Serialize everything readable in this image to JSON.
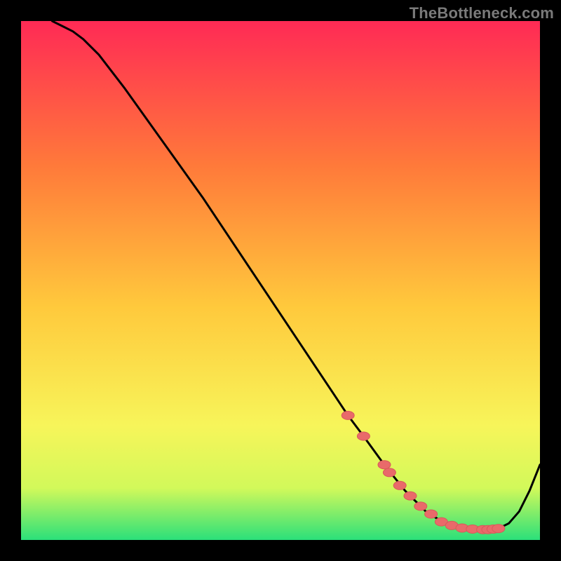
{
  "watermark": "TheBottleneck.com",
  "colors": {
    "gradient_top": "#ff2a55",
    "gradient_mid_upper": "#ff7a3a",
    "gradient_mid": "#ffc93c",
    "gradient_mid_lower": "#f7f55a",
    "gradient_green_top": "#d2f95a",
    "gradient_green": "#2be07a",
    "curve": "#000000",
    "marker": "#e96a6a",
    "marker_stroke": "#d85a5a",
    "frame": "#000000"
  },
  "chart_data": {
    "type": "line",
    "title": "",
    "xlabel": "",
    "ylabel": "",
    "xlim": [
      0,
      100
    ],
    "ylim": [
      0,
      100
    ],
    "series": [
      {
        "name": "bottleneck-curve",
        "x": [
          6,
          8,
          10,
          12,
          15,
          20,
          25,
          30,
          35,
          40,
          45,
          50,
          55,
          60,
          63,
          66,
          70,
          74,
          78,
          82,
          86,
          88,
          90,
          92,
          94,
          96,
          98,
          100
        ],
        "y": [
          100,
          99,
          98,
          96.5,
          93.5,
          87,
          80,
          73,
          66,
          58.5,
          51,
          43.5,
          36,
          28.5,
          24,
          20,
          14.5,
          9.5,
          5.5,
          3,
          2.2,
          2.0,
          2.0,
          2.2,
          3.2,
          5.5,
          9.5,
          14.5
        ]
      }
    ],
    "markers": {
      "name": "highlight-points",
      "x": [
        63,
        66,
        70,
        71,
        73,
        75,
        77,
        79,
        81,
        83,
        85,
        87,
        89,
        90,
        91,
        92
      ],
      "y": [
        24,
        20,
        14.5,
        13.0,
        10.5,
        8.5,
        6.5,
        5.0,
        3.5,
        2.8,
        2.3,
        2.1,
        2.0,
        2.0,
        2.1,
        2.2
      ]
    }
  }
}
